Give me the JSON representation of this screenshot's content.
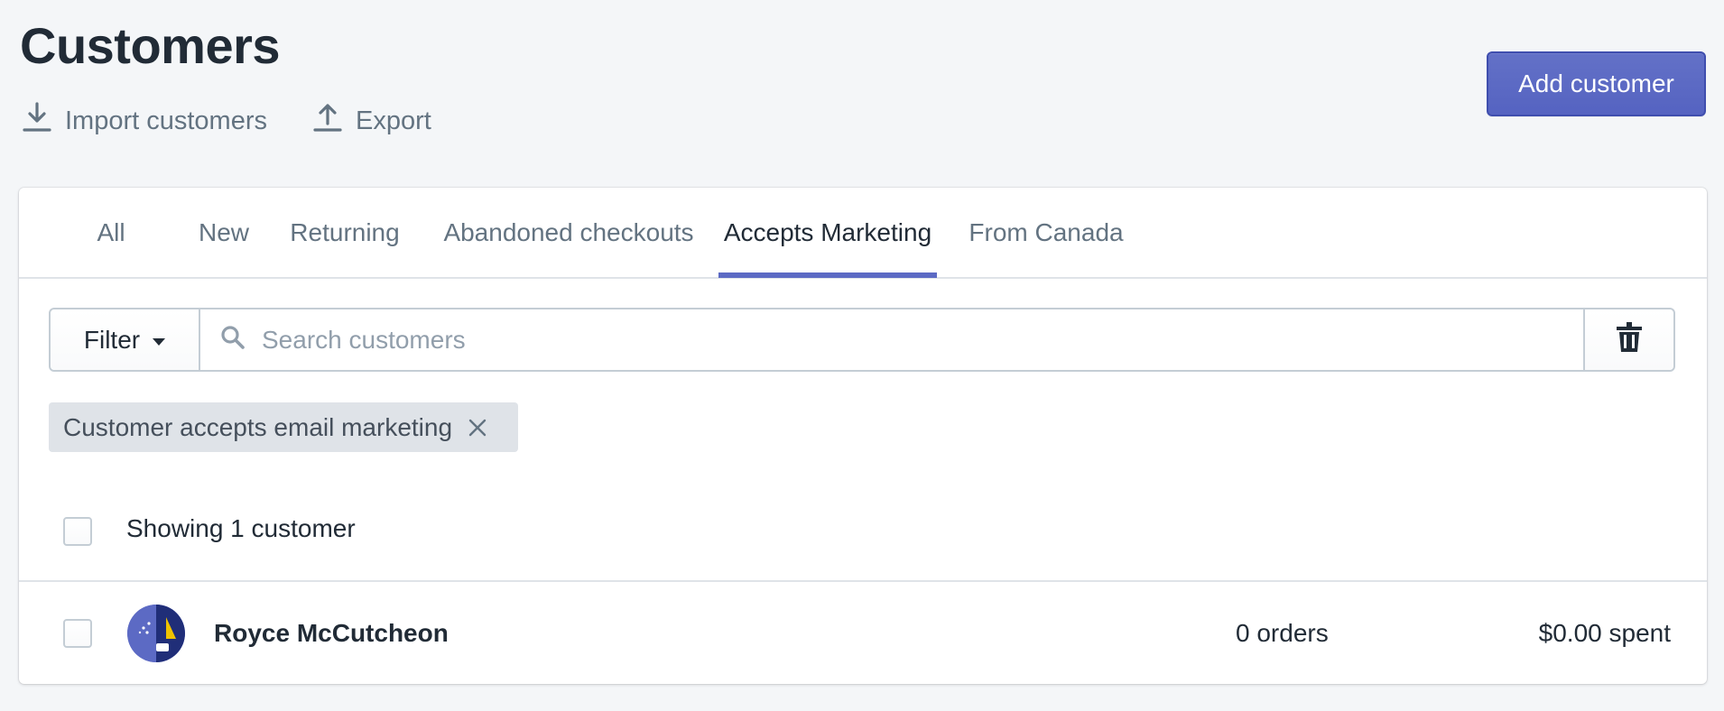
{
  "header": {
    "title": "Customers",
    "actions": [
      {
        "label": "Import customers",
        "icon": "import-icon"
      },
      {
        "label": "Export",
        "icon": "export-icon"
      }
    ],
    "primary_button": "Add customer"
  },
  "tabs": [
    {
      "label": "All"
    },
    {
      "label": "New"
    },
    {
      "label": "Returning"
    },
    {
      "label": "Abandoned checkouts"
    },
    {
      "label": "Accepts Marketing",
      "active": true
    },
    {
      "label": "From Canada"
    }
  ],
  "filter": {
    "button_label": "Filter",
    "search_placeholder": "Search customers",
    "search_value": "",
    "applied": [
      {
        "label": "Customer accepts email marketing"
      }
    ]
  },
  "list": {
    "summary": "Showing 1 customer",
    "rows": [
      {
        "name": "Royce McCutcheon",
        "orders": "0 orders",
        "spent": "$0.00 spent"
      }
    ]
  },
  "colors": {
    "accent": "#5c6ac4",
    "background": "#f4f6f8",
    "text": "#212b36",
    "subdued": "#637381"
  }
}
